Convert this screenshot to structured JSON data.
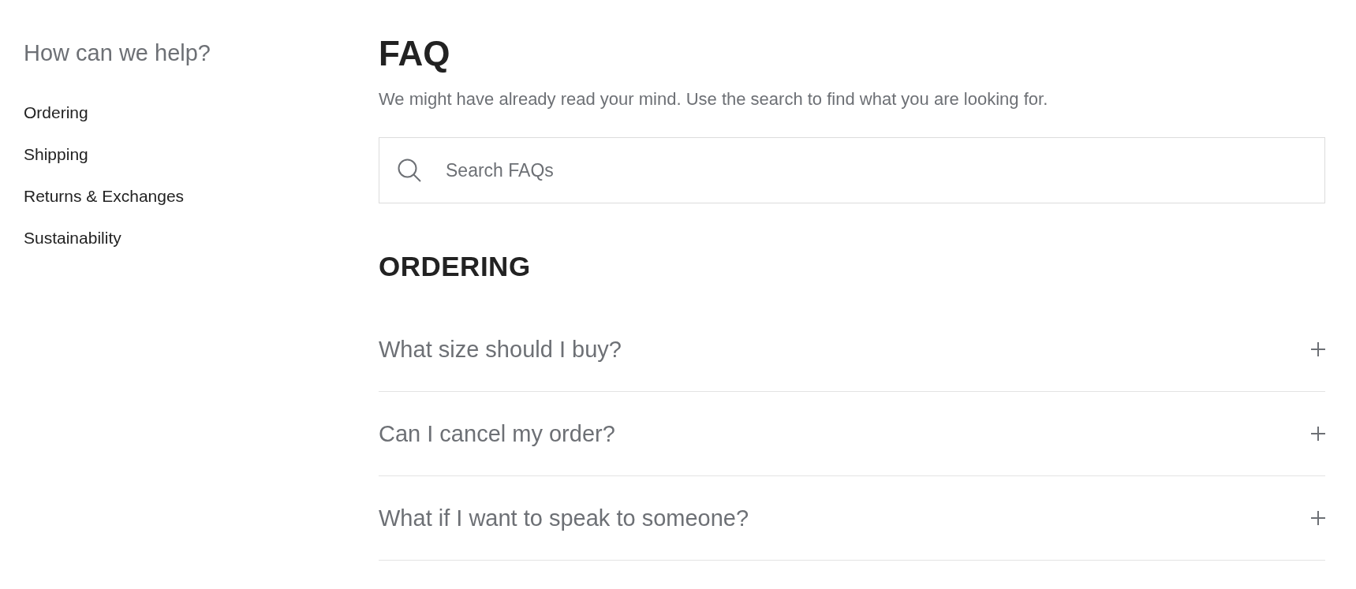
{
  "sidebar": {
    "title": "How can we help?",
    "items": [
      {
        "label": "Ordering"
      },
      {
        "label": "Shipping"
      },
      {
        "label": "Returns & Exchanges"
      },
      {
        "label": "Sustainability"
      }
    ]
  },
  "header": {
    "title": "FAQ",
    "subtitle": "We might have already read your mind. Use the search to find what you are looking for."
  },
  "search": {
    "placeholder": "Search FAQs"
  },
  "sections": [
    {
      "title": "ORDERING",
      "questions": [
        {
          "text": "What size should I buy?",
          "expanded": false
        },
        {
          "text": "Can I cancel my order?",
          "expanded": false
        },
        {
          "text": "What if I want to speak to someone?",
          "expanded": false
        }
      ]
    }
  ]
}
